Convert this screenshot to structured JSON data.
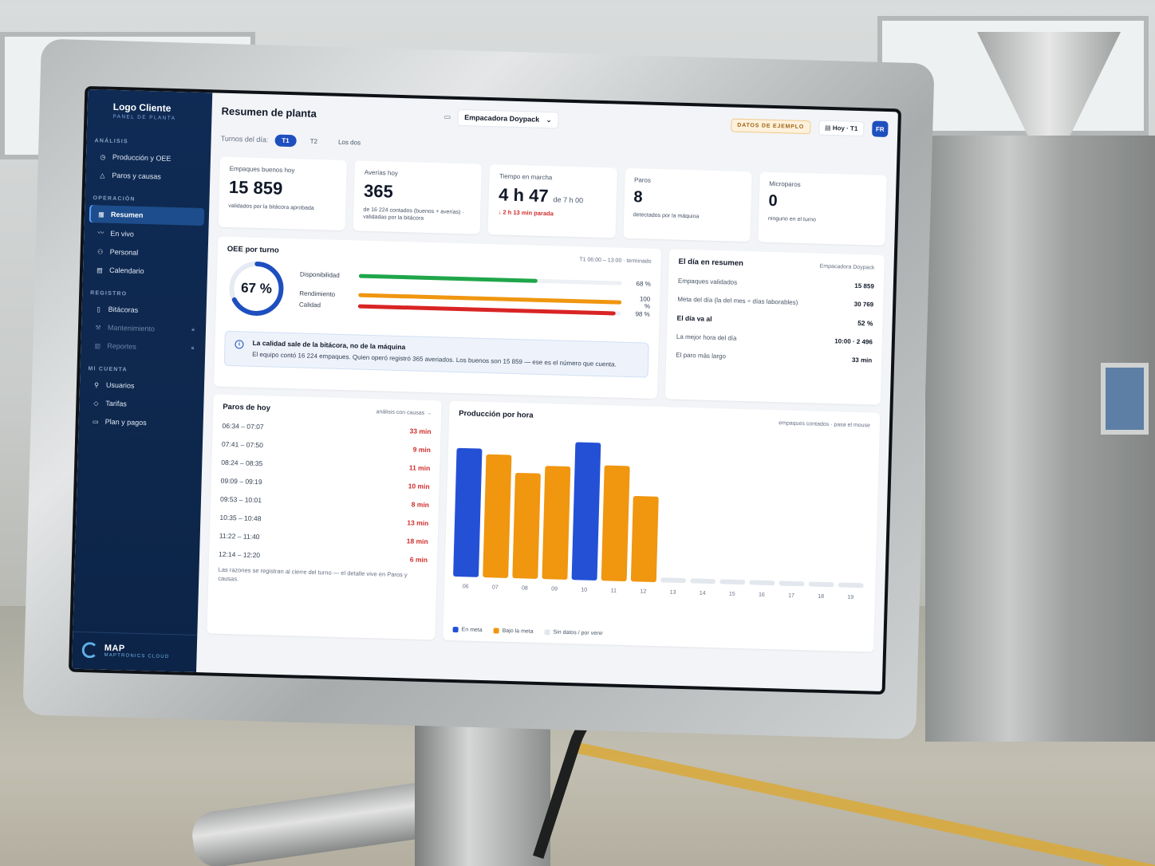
{
  "brand": {
    "title": "Logo Cliente",
    "subtitle": "PANEL DE PLANTA"
  },
  "nav": {
    "sections": [
      {
        "title": "ANÁLISIS",
        "items": [
          {
            "label": "Producción y OEE",
            "icon": "clock-icon",
            "state": "normal"
          },
          {
            "label": "Paros y causas",
            "icon": "warning-icon",
            "state": "normal"
          }
        ]
      },
      {
        "title": "OPERACIÓN",
        "items": [
          {
            "label": "Resumen",
            "icon": "grid-icon",
            "state": "active"
          },
          {
            "label": "En vivo",
            "icon": "pulse-icon",
            "state": "normal"
          },
          {
            "label": "Personal",
            "icon": "people-icon",
            "state": "normal"
          },
          {
            "label": "Calendario",
            "icon": "calendar-icon",
            "state": "normal"
          }
        ]
      },
      {
        "title": "REGISTRO",
        "items": [
          {
            "label": "Bitácoras",
            "icon": "logbook-icon",
            "state": "normal"
          },
          {
            "label": "Mantenimiento",
            "icon": "wrench-icon",
            "state": "locked"
          },
          {
            "label": "Reportes",
            "icon": "bar-chart-icon",
            "state": "locked"
          }
        ]
      },
      {
        "title": "MI CUENTA",
        "items": [
          {
            "label": "Usuarios",
            "icon": "user-icon",
            "state": "normal"
          },
          {
            "label": "Tarifas",
            "icon": "tag-icon",
            "state": "normal"
          },
          {
            "label": "Plan y pagos",
            "icon": "card-icon",
            "state": "normal"
          }
        ]
      }
    ]
  },
  "footer": {
    "title": "MAP",
    "subtitle": "MAPTRONICS CLOUD"
  },
  "header": {
    "title": "Resumen de planta",
    "machine": "Empacadora Doypack",
    "sample_badge": "DATOS DE EJEMPLO",
    "date": "Hoy · T1",
    "avatar": "FR"
  },
  "shifts": {
    "label": "Turnos del día:",
    "tabs": [
      "T1",
      "T2",
      "Los dos"
    ],
    "active": 0
  },
  "kpis": {
    "good": {
      "label": "Empaques buenos hoy",
      "value": "15 859",
      "note": "validados por la bitácora aprobada"
    },
    "faults": {
      "label": "Averías hoy",
      "value": "365",
      "note": "de 16 224 contados (buenos + averías) · validadas por la bitácora"
    },
    "runtime": {
      "label": "Tiempo en marcha",
      "value": "4 h 47",
      "unit": "de 7 h 00",
      "alert": "2 h 13 min parada"
    },
    "stops": {
      "label": "Paros",
      "value": "8",
      "note": "detectados por la máquina"
    },
    "micro": {
      "label": "Microparos",
      "value": "0",
      "note": "ninguno en el turno"
    }
  },
  "oee": {
    "title": "OEE por turno",
    "meta": "T1 06:00 – 13:00 · terminado",
    "value": 67,
    "value_label": "67 %",
    "metrics": [
      {
        "label": "Disponibilidad",
        "value": 68,
        "value_label": "68 %",
        "color": "#1fa64a"
      },
      {
        "label": "Rendimiento",
        "value": 100,
        "value_label": "100 %",
        "color": "#f0960f"
      },
      {
        "label": "Calidad",
        "value": 98,
        "value_label": "98 %",
        "color": "#d92424"
      }
    ],
    "info_title": "La calidad sale de la bitácora, no de la máquina",
    "info_text": "El equipo contó 16 224 empaques. Quien operó registró 365 averiados. Los buenos son 15 859 — ese es el número que cuenta."
  },
  "summary": {
    "title": "El día en resumen",
    "meta": "Empacadora Doypack",
    "rows": [
      {
        "label": "Empaques validados",
        "value": "15 859",
        "strong": false
      },
      {
        "label": "Meta del día (la del mes ÷ días laborables)",
        "value": "30 769",
        "strong": false
      },
      {
        "label": "El día va al",
        "value": "52 %",
        "strong": true
      },
      {
        "label": "La mejor hora del día",
        "value": "10:00 · 2 496",
        "strong": false
      },
      {
        "label": "El paro más largo",
        "value": "33 min",
        "strong": false
      }
    ]
  },
  "stops_today": {
    "title": "Paros de hoy",
    "link": "análisis con causas →",
    "rows": [
      {
        "range": "06:34 – 07:07",
        "duration": "33 min"
      },
      {
        "range": "07:41 – 07:50",
        "duration": "9 min"
      },
      {
        "range": "08:24 – 08:35",
        "duration": "11 min"
      },
      {
        "range": "09:09 – 09:19",
        "duration": "10 min"
      },
      {
        "range": "09:53 – 10:01",
        "duration": "8 min"
      },
      {
        "range": "10:35 – 10:48",
        "duration": "13 min"
      },
      {
        "range": "11:22 – 11:40",
        "duration": "18 min"
      },
      {
        "range": "12:14 – 12:20",
        "duration": "6 min"
      }
    ],
    "footnote": "Las razones se registran al cierre del turno — el detalle vive en Paros y causas."
  },
  "production": {
    "title": "Producción por hora",
    "meta": "empaques contados · pasa el mouse",
    "legend": [
      "En meta",
      "Bajo la meta",
      "Sin datos / por venir"
    ]
  },
  "colors": {
    "meet": "#2450d6",
    "below": "#f0960f",
    "nodata": "#e3e7ee",
    "accent": "#1e4fbf"
  },
  "chart_data": {
    "type": "bar",
    "title": "Producción por hora",
    "categories": [
      "06",
      "07",
      "08",
      "09",
      "10",
      "11",
      "12",
      "13",
      "14",
      "15",
      "16",
      "17",
      "18",
      "19"
    ],
    "values": [
      2330,
      2230,
      1910,
      2050,
      2496,
      2090,
      1550,
      null,
      null,
      null,
      null,
      null,
      null,
      null
    ],
    "status": [
      "meet",
      "below",
      "below",
      "below",
      "meet",
      "below",
      "below",
      "nodata",
      "nodata",
      "nodata",
      "nodata",
      "nodata",
      "nodata",
      "nodata"
    ],
    "ylim": [
      0,
      2600
    ],
    "grid": false,
    "legend_position": "bottom-left"
  }
}
